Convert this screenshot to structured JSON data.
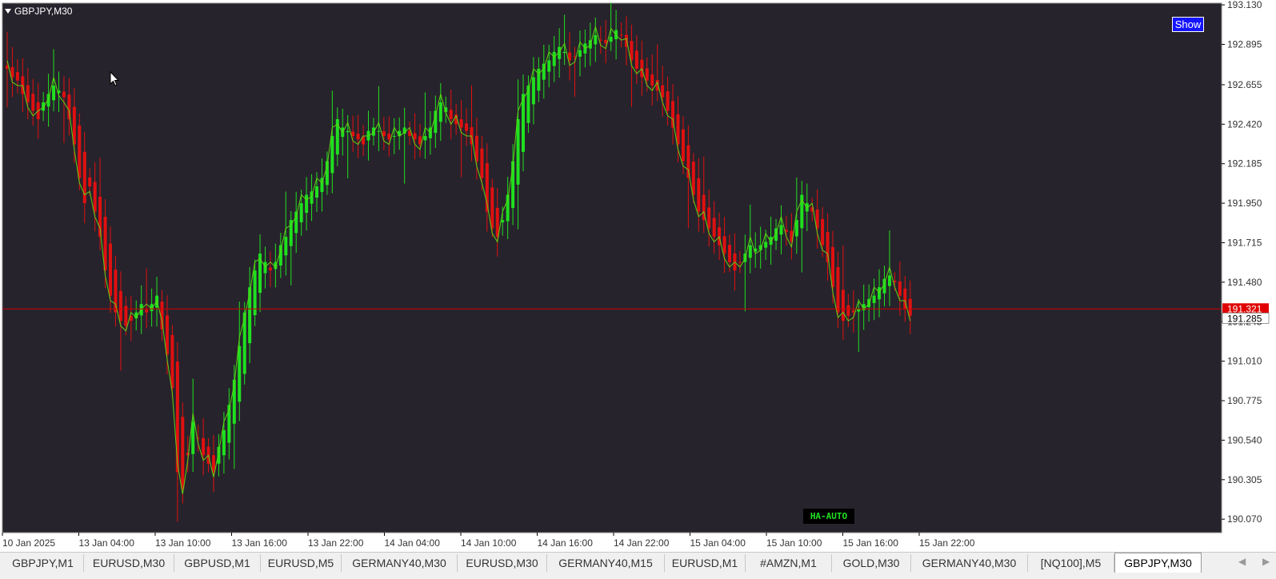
{
  "window": {
    "symbol_label": "GBPJPY,M30"
  },
  "show_button": {
    "label": "Show"
  },
  "indicator_badge": {
    "label": "HA-AUTO"
  },
  "colors": {
    "background": "#27232c",
    "bull": "#1fe01f",
    "bear": "#e01010",
    "ha_line": "#5fd314",
    "price_line": "#d00000",
    "ask_box": "#e00000",
    "bid_box": "#ffffff"
  },
  "price_labels": {
    "ask": "191.321",
    "bid": "191.285"
  },
  "tabs": [
    {
      "label": "GBPJPY,M1",
      "active": false
    },
    {
      "label": "EURUSD,M30",
      "active": false
    },
    {
      "label": "GBPUSD,M1",
      "active": false
    },
    {
      "label": "EURUSD,M5",
      "active": false
    },
    {
      "label": "GERMANY40,M30",
      "active": false
    },
    {
      "label": "EURUSD,M30",
      "active": false
    },
    {
      "label": "GERMANY40,M15",
      "active": false
    },
    {
      "label": "EURUSD,M1",
      "active": false
    },
    {
      "label": "#AMZN,M1",
      "active": false
    },
    {
      "label": "GOLD,M30",
      "active": false
    },
    {
      "label": "GERMANY40,M30",
      "active": false
    },
    {
      "label": "[NQ100],M5",
      "active": false
    },
    {
      "label": "GBPJPY,M30",
      "active": true
    }
  ],
  "tab_scroll": {
    "left_icon": "scroll-left-icon",
    "right_icon": "scroll-right-icon"
  },
  "chart_data": {
    "type": "candlestick",
    "symbol": "GBPJPY",
    "timeframe": "M30",
    "y_ticks": [
      "193.130",
      "192.895",
      "192.655",
      "192.420",
      "192.185",
      "191.950",
      "191.715",
      "191.480",
      "191.245",
      "191.010",
      "190.775",
      "190.540",
      "190.305",
      "190.070"
    ],
    "x_ticks": [
      "10 Jan 2025",
      "13 Jan 04:00",
      "13 Jan 10:00",
      "13 Jan 16:00",
      "13 Jan 22:00",
      "14 Jan 04:00",
      "14 Jan 10:00",
      "14 Jan 16:00",
      "14 Jan 22:00",
      "15 Jan 04:00",
      "15 Jan 10:00",
      "15 Jan 16:00",
      "15 Jan 22:00"
    ],
    "ylim": [
      189.99,
      193.14
    ],
    "current_price": 191.321,
    "close_series": [
      192.75,
      192.7,
      192.68,
      192.6,
      192.55,
      192.5,
      192.45,
      192.55,
      192.6,
      192.65,
      192.62,
      192.58,
      192.45,
      192.3,
      192.1,
      191.95,
      192.05,
      191.9,
      191.75,
      191.55,
      191.4,
      191.3,
      191.25,
      191.22,
      191.25,
      191.3,
      191.35,
      191.3,
      191.35,
      191.4,
      191.2,
      191.05,
      190.85,
      190.35,
      190.25,
      190.45,
      190.65,
      190.55,
      190.45,
      190.4,
      190.35,
      190.5,
      190.6,
      190.75,
      190.9,
      191.1,
      191.3,
      191.45,
      191.55,
      191.65,
      191.6,
      191.55,
      191.6,
      191.7,
      191.75,
      191.85,
      191.9,
      191.95,
      192.0,
      192.02,
      192.05,
      192.1,
      192.2,
      192.35,
      192.45,
      192.4,
      192.38,
      192.35,
      192.33,
      192.3,
      192.38,
      192.4,
      192.38,
      192.35,
      192.33,
      192.35,
      192.38,
      192.4,
      192.35,
      192.33,
      192.3,
      192.35,
      192.4,
      192.5,
      192.55,
      192.52,
      192.45,
      192.42,
      192.4,
      192.38,
      192.3,
      192.2,
      192.1,
      191.9,
      191.8,
      191.75,
      191.85,
      192.0,
      192.2,
      192.45,
      192.6,
      192.65,
      192.7,
      192.75,
      192.78,
      192.8,
      192.85,
      192.88,
      192.85,
      192.8,
      192.82,
      192.86,
      192.9,
      192.92,
      192.95,
      192.92,
      192.9,
      192.94,
      192.98,
      192.95,
      192.88,
      192.8,
      192.75,
      192.7,
      192.68,
      192.65,
      192.62,
      192.58,
      192.5,
      192.4,
      192.3,
      192.2,
      192.1,
      192.0,
      191.9,
      191.85,
      191.8,
      191.75,
      191.7,
      191.65,
      191.6,
      191.55,
      191.6,
      191.65,
      191.7,
      191.68,
      191.7,
      191.72,
      191.75,
      191.8,
      191.82,
      191.78,
      191.72,
      191.85,
      192.0,
      191.95,
      191.9,
      191.8,
      191.7,
      191.6,
      191.45,
      191.3,
      191.25,
      191.28,
      191.3,
      191.32,
      191.35,
      191.38,
      191.4,
      191.45,
      191.5,
      191.52,
      191.48,
      191.4,
      191.32,
      191.28
    ]
  }
}
